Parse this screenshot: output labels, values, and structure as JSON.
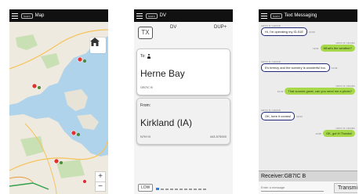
{
  "screens": {
    "map": {
      "title": "Map",
      "logo": "Icom",
      "home_icon": "home-icon",
      "zoom_in": "+",
      "zoom_out": "−"
    },
    "dv": {
      "title": "DV",
      "logo": "Icom",
      "tx_label": "TX",
      "mode": "DV",
      "duplex": "DUP+",
      "to_label": "To:",
      "to_name": "Herne Bay",
      "to_code": "GB7IC B",
      "from_label": "From:",
      "from_name": "Kirkland (IA)",
      "from_code": "N7IH B",
      "from_freq": "443.575000",
      "power_label": "LOW"
    },
    "text": {
      "title": "Text Messaging",
      "logo": "Icom",
      "messages": [
        {
          "dir": "in",
          "meta": "GB7IC B / G4DCB",
          "text": "Hi, I'm operating my ID-51E",
          "time": "12:00"
        },
        {
          "dir": "out",
          "meta": "GB7IC B / M0ABC",
          "text": "What's the weather?",
          "time": "12:01"
        },
        {
          "dir": "in",
          "meta": "GB7IC B / G4DCB",
          "text": "It's breezy and the scenery is wonderful too.",
          "time": "12:02"
        },
        {
          "dir": "out",
          "meta": "GB7IC B / M0ABC",
          "text": "That sounds great, can you send me a photo?",
          "time": "12:03"
        },
        {
          "dir": "in",
          "meta": "GB7IC B / G4DCB",
          "text": "OK, here it comes!",
          "time": "12:04"
        },
        {
          "dir": "out",
          "meta": "GB7IC B / M0ABC",
          "text": "OK, got it! Thanks!",
          "time": "12:05"
        }
      ],
      "receiver": "Receiver:GB7IC B",
      "input_placeholder": "Enter a message",
      "transmit_label": "Transmit"
    }
  }
}
